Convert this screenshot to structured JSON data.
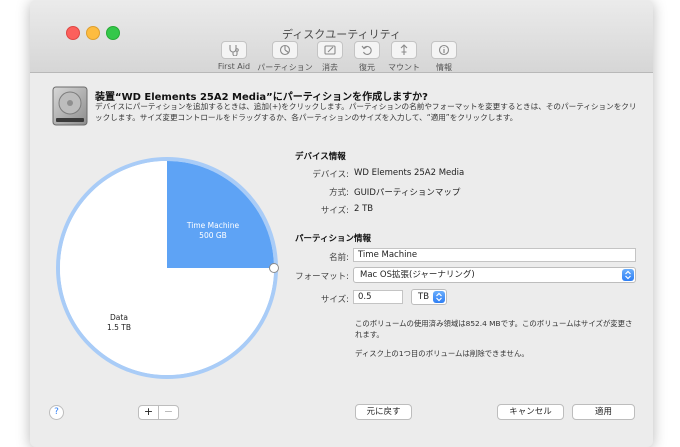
{
  "window": {
    "title": "ディスクユーティリティ",
    "toolbar": [
      {
        "label": "First Aid",
        "icon": "stethoscope-icon"
      },
      {
        "label": "パーティション",
        "icon": "pie-partition-icon"
      },
      {
        "label": "消去",
        "icon": "erase-icon"
      },
      {
        "label": "復元",
        "icon": "restore-icon"
      },
      {
        "label": "マウント",
        "icon": "mount-icon"
      },
      {
        "label": "情報",
        "icon": "info-icon"
      }
    ]
  },
  "sheet": {
    "title": "装置“WD Elements 25A2 Media”にパーティションを作成しますか?",
    "description": "デバイスにパーティションを追加するときは、追加(+)をクリックします。パーティションの名前やフォーマットを変更するときは、そのパーティションをクリックします。サイズ変更コントロールをドラッグするか、各パーティションのサイズを入力して、“適用”をクリックします。"
  },
  "pie": {
    "partitions": [
      {
        "name": "Time Machine",
        "size": "500 GB",
        "fraction": 0.25,
        "color": "#5ea3f5"
      },
      {
        "name": "Data",
        "size": "1.5 TB",
        "fraction": 0.75,
        "color": "#ffffff"
      }
    ],
    "ring_color": "#a9ccf7"
  },
  "device_info": {
    "heading": "デバイス情報",
    "device_label": "デバイス:",
    "device_value": "WD Elements 25A2 Media",
    "scheme_label": "方式:",
    "scheme_value": "GUIDパーティションマップ",
    "size_label": "サイズ:",
    "size_value": "2 TB"
  },
  "partition_info": {
    "heading": "パーティション情報",
    "name_label": "名前:",
    "name_value": "Time Machine",
    "format_label": "フォーマット:",
    "format_value": "Mac OS拡張(ジャーナリング)",
    "size_label": "サイズ:",
    "size_value": "0.5",
    "size_unit": "TB",
    "note1": "このボリュームの使用済み領域は852.4 MBです。このボリュームはサイズが変更されます。",
    "note2": "ディスク上の1つ目のボリュームは削除できません。"
  },
  "buttons": {
    "help": "?",
    "add": "+",
    "remove": "−",
    "revert": "元に戻す",
    "cancel": "キャンセル",
    "apply": "適用"
  },
  "colors": {
    "accent": "#2f7ff5"
  }
}
